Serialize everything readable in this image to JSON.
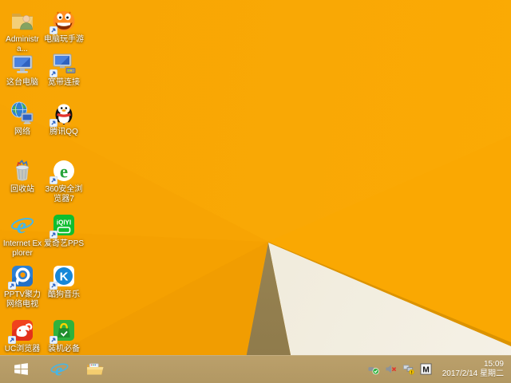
{
  "wallpaper": {
    "base_color": "#f9a805",
    "facet_white_color": "#f2eee1",
    "facet_olive_color": "#a08b57",
    "crease_color": "#dc9300"
  },
  "desktop": {
    "icons": [
      {
        "icon": "user-folder-icon",
        "label": "Administra...",
        "col": 1,
        "row": 1,
        "shortcut": false
      },
      {
        "icon": "game-monster-icon",
        "label": "电脑玩手游",
        "col": 2,
        "row": 1,
        "shortcut": true
      },
      {
        "icon": "this-pc-icon",
        "label": "这台电脑",
        "col": 1,
        "row": 2,
        "shortcut": false
      },
      {
        "icon": "broadband-icon",
        "label": "宽带连接",
        "col": 2,
        "row": 2,
        "shortcut": true
      },
      {
        "icon": "network-icon",
        "label": "网络",
        "col": 1,
        "row": 3,
        "shortcut": false
      },
      {
        "icon": "qq-icon",
        "label": "腾讯QQ",
        "col": 2,
        "row": 3,
        "shortcut": true
      },
      {
        "icon": "recycle-bin-icon",
        "label": "回收站",
        "col": 1,
        "row": 4,
        "shortcut": false
      },
      {
        "icon": "browser-360-icon",
        "label": "360安全浏览器7",
        "col": 2,
        "row": 4,
        "shortcut": true
      },
      {
        "icon": "ie-icon",
        "label": "Internet Explorer",
        "col": 1,
        "row": 5,
        "shortcut": false
      },
      {
        "icon": "iqiyi-icon",
        "label": "爱奇艺PPS",
        "col": 2,
        "row": 5,
        "shortcut": true
      },
      {
        "icon": "pptv-icon",
        "label": "PPTV聚力 网络电视",
        "col": 1,
        "row": 6,
        "shortcut": true
      },
      {
        "icon": "kugou-icon",
        "label": "酷狗音乐",
        "col": 2,
        "row": 6,
        "shortcut": true
      },
      {
        "icon": "uc-icon",
        "label": "UC浏览器",
        "col": 1,
        "row": 7,
        "shortcut": true
      },
      {
        "icon": "bag-icon",
        "label": "装机必备",
        "col": 2,
        "row": 7,
        "shortcut": true
      }
    ]
  },
  "taskbar": {
    "color": "#b79d68",
    "buttons": [
      {
        "name": "start-button",
        "icon": "windows-flag-icon"
      },
      {
        "name": "taskbar-ie-button",
        "icon": "ie-icon"
      },
      {
        "name": "taskbar-explorer-button",
        "icon": "folder-icon"
      }
    ],
    "tray": {
      "icons": [
        {
          "name": "usb-safely-remove-tray",
          "icon": "usb-safely-remove-icon"
        },
        {
          "name": "volume-muted-tray",
          "icon": "volume-muted-icon"
        },
        {
          "name": "network-status-tray",
          "icon": "network-warning-icon"
        },
        {
          "name": "input-method-tray",
          "icon": "ime-m-icon"
        }
      ],
      "clock": {
        "time": "15:09",
        "date": "2017/2/14 星期二"
      }
    }
  }
}
